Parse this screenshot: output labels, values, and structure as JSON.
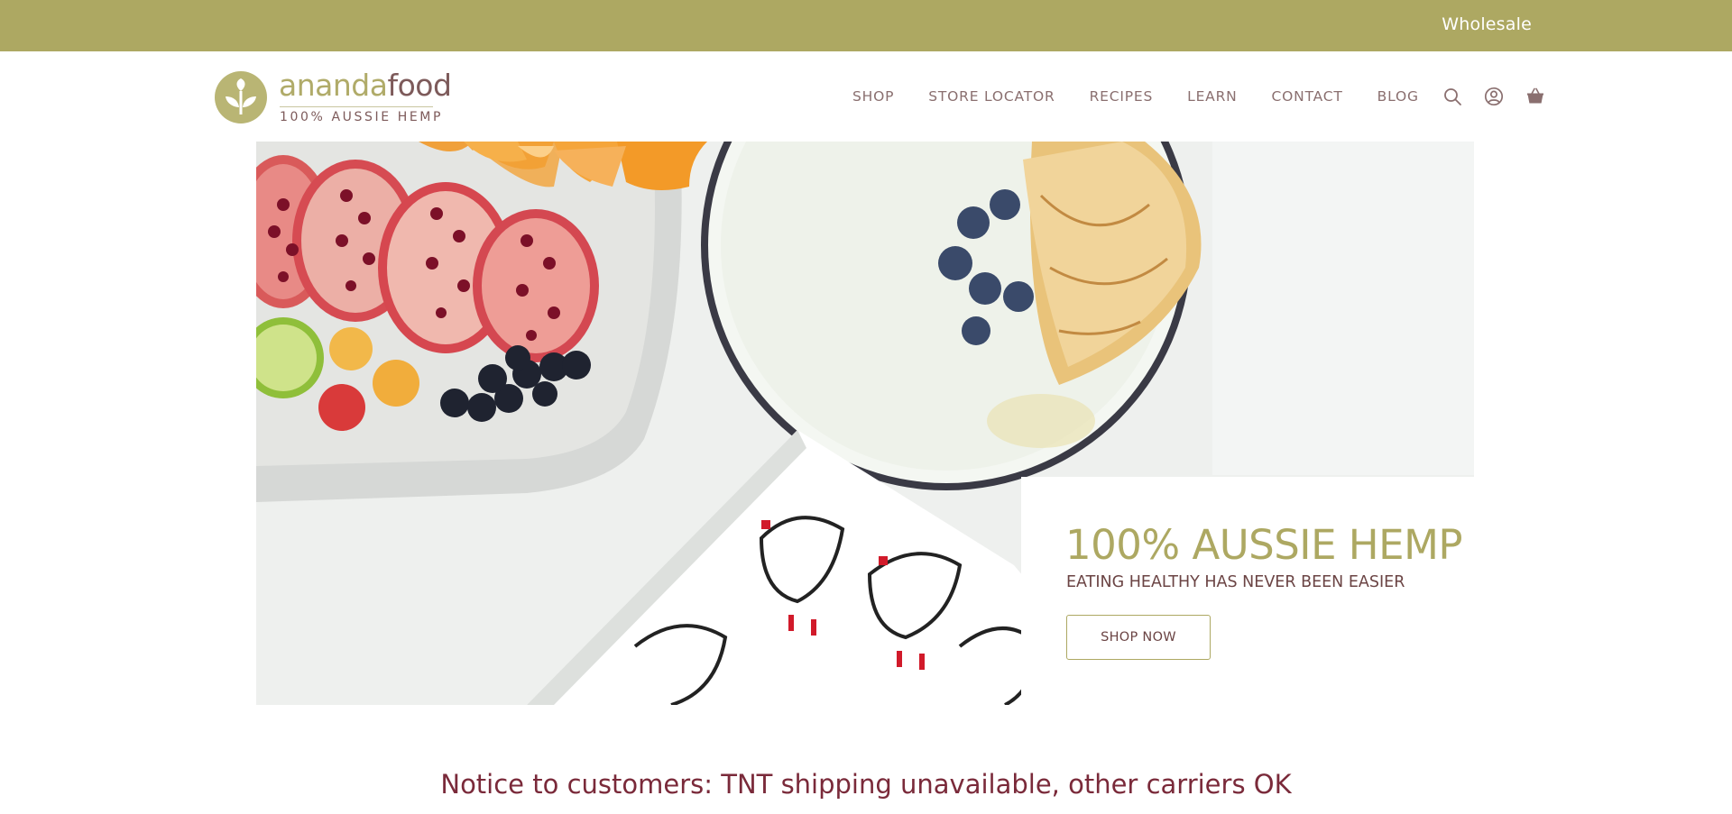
{
  "topbar": {
    "wholesale_label": "Wholesale"
  },
  "logo": {
    "word_part1": "ananda",
    "word_part2": "food",
    "tagline": "100% AUSSIE HEMP"
  },
  "nav": {
    "items": [
      {
        "label": "SHOP"
      },
      {
        "label": "STORE LOCATOR"
      },
      {
        "label": "RECIPES"
      },
      {
        "label": "LEARN"
      },
      {
        "label": "CONTACT"
      },
      {
        "label": "BLOG"
      }
    ],
    "icons": [
      "search-icon",
      "account-icon",
      "basket-icon"
    ]
  },
  "hero": {
    "title": "100% AUSSIE HEMP",
    "subtitle": "EATING HEALTHY HAS NEVER BEEN EASIER",
    "button_label": "SHOP NOW"
  },
  "notice": {
    "text": "Notice to customers: TNT shipping unavailable, other carriers OK"
  },
  "colors": {
    "brand_olive": "#ada862",
    "brand_maroon": "#7a2a3a",
    "text_muted": "#8a6f6f"
  }
}
